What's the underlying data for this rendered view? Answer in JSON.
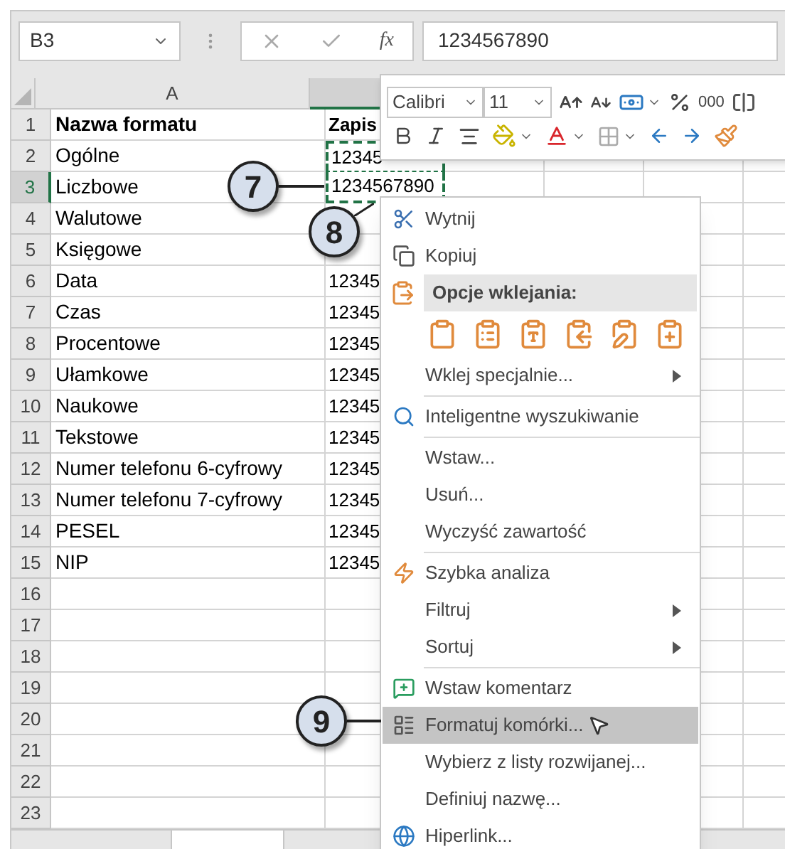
{
  "formula_bar": {
    "name_box": "B3",
    "function_label": "fx",
    "formula": "1234567890"
  },
  "columns": [
    {
      "label": "A",
      "selected": false
    },
    {
      "selected": true
    }
  ],
  "rows": [
    {
      "number": "1",
      "kind": "header",
      "a": "Nazwa formatu",
      "b": "Zapis",
      "selected": false,
      "copied": false
    },
    {
      "number": "2",
      "kind": "data",
      "a": "Ogólne",
      "b": "12345",
      "selected": false,
      "copied": true
    },
    {
      "number": "3",
      "kind": "data",
      "a": "Liczbowe",
      "b": "1234567890",
      "selected": true,
      "copied": true
    },
    {
      "number": "4",
      "kind": "data",
      "a": "Walutowe",
      "selected": false,
      "copied": false
    },
    {
      "number": "5",
      "kind": "data",
      "a": "Księgowe",
      "selected": false,
      "copied": false
    },
    {
      "number": "6",
      "kind": "data",
      "a": "Data",
      "b": "12345",
      "selected": false,
      "copied": false
    },
    {
      "number": "7",
      "kind": "data",
      "a": "Czas",
      "b": "12345",
      "selected": false,
      "copied": false
    },
    {
      "number": "8",
      "kind": "data",
      "a": "Procentowe",
      "b": "12345",
      "selected": false,
      "copied": false
    },
    {
      "number": "9",
      "kind": "data",
      "a": "Ułamkowe",
      "b": "12345",
      "selected": false,
      "copied": false
    },
    {
      "number": "10",
      "kind": "data",
      "a": "Naukowe",
      "b": "12345",
      "selected": false,
      "copied": false
    },
    {
      "number": "11",
      "kind": "data",
      "a": "Tekstowe",
      "b": "12345",
      "selected": false,
      "copied": false
    },
    {
      "number": "12",
      "kind": "data",
      "a": "Numer telefonu 6-cyfrowy",
      "b": "12345",
      "selected": false,
      "copied": false
    },
    {
      "number": "13",
      "kind": "data",
      "a": "Numer telefonu 7-cyfrowy",
      "b": "12345",
      "selected": false,
      "copied": false
    },
    {
      "number": "14",
      "kind": "data",
      "a": "PESEL",
      "b": "12345",
      "selected": false,
      "copied": false
    },
    {
      "number": "15",
      "kind": "data",
      "a": "NIP",
      "b": "12345",
      "selected": false,
      "copied": false
    },
    {
      "number": "16",
      "kind": "data",
      "selected": false,
      "copied": false
    },
    {
      "number": "17",
      "kind": "data",
      "selected": false,
      "copied": false
    },
    {
      "number": "18",
      "kind": "data",
      "selected": false,
      "copied": false
    },
    {
      "number": "19",
      "kind": "data",
      "selected": false,
      "copied": false
    },
    {
      "number": "20",
      "kind": "data",
      "selected": false,
      "copied": false
    },
    {
      "number": "21",
      "kind": "data",
      "selected": false,
      "copied": false
    },
    {
      "number": "22",
      "kind": "data",
      "selected": false,
      "copied": false
    },
    {
      "number": "23",
      "kind": "data",
      "selected": false,
      "copied": false
    }
  ],
  "mini_toolbar": {
    "font": "Calibri",
    "size": "11",
    "comma_style": "000"
  },
  "context_menu": [
    {
      "kind": "command",
      "label": "Wytnij",
      "selected": false,
      "submenu": false
    },
    {
      "kind": "command",
      "label": "Kopiuj",
      "selected": false,
      "submenu": false
    },
    {
      "kind": "header",
      "label": "Opcje wklejania:"
    },
    {
      "kind": "paste_options"
    },
    {
      "kind": "command",
      "label": "Wklej specjalnie...",
      "selected": false,
      "submenu": true
    },
    {
      "kind": "separator"
    },
    {
      "kind": "command",
      "label": "Inteligentne wyszukiwanie",
      "selected": false,
      "submenu": false
    },
    {
      "kind": "separator"
    },
    {
      "kind": "command",
      "label": "Wstaw...",
      "selected": false,
      "submenu": false
    },
    {
      "kind": "command",
      "label": "Usuń...",
      "selected": false,
      "submenu": false
    },
    {
      "kind": "command",
      "label": "Wyczyść zawartość",
      "selected": false,
      "submenu": false
    },
    {
      "kind": "separator"
    },
    {
      "kind": "command",
      "label": "Szybka analiza",
      "selected": false,
      "submenu": false
    },
    {
      "kind": "command",
      "label": "Filtruj",
      "selected": false,
      "submenu": true
    },
    {
      "kind": "command",
      "label": "Sortuj",
      "selected": false,
      "submenu": true
    },
    {
      "kind": "separator"
    },
    {
      "kind": "command",
      "label": "Wstaw komentarz",
      "selected": false,
      "submenu": false
    },
    {
      "kind": "command",
      "label": "Formatuj komórki...",
      "selected": true,
      "submenu": false
    },
    {
      "kind": "command",
      "label": "Wybierz z listy rozwijanej...",
      "selected": false,
      "submenu": false
    },
    {
      "kind": "command",
      "label": "Definiuj nazwę...",
      "selected": false,
      "submenu": false
    },
    {
      "kind": "command",
      "label": "Hiperlink...",
      "selected": false,
      "submenu": false
    }
  ],
  "callouts": [
    {
      "number": "7"
    },
    {
      "number": "8"
    },
    {
      "number": "9"
    }
  ]
}
